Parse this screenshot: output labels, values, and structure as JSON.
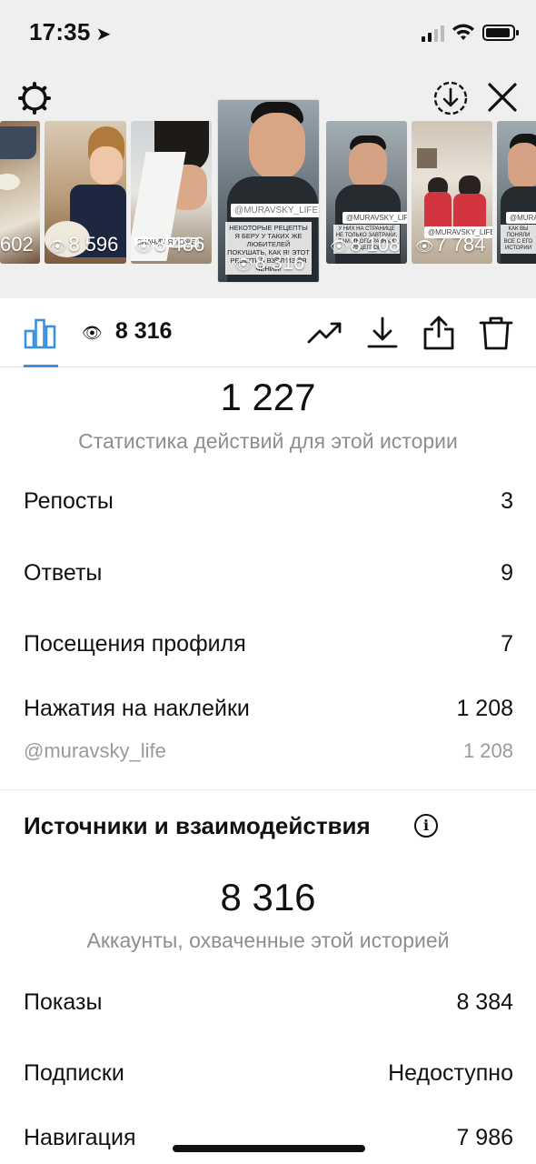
{
  "status_bar": {
    "time": "17:35",
    "location_glyph": "➤"
  },
  "header": {
    "settings_icon": "gear-icon",
    "download_icon": "download-circle-icon",
    "close_icon": "close-icon"
  },
  "thumbnails": [
    {
      "count": "602",
      "partial": true
    },
    {
      "count": "8 596"
    },
    {
      "count": "8 486",
      "overlay_text": "ЗНАЧИТ Я ТОЖЕ"
    },
    {
      "count": "8 316",
      "selected": true,
      "tag": "@MURAVSKY_LIFE",
      "caption": "НЕКОТОРЫЕ РЕЦЕПТЫ Я БЕРУ У ТАКИХ ЖЕ ЛЮБИТЕЛЕЙ ПОКУШАТЬ, КАК Я! ЭТОТ РЕЦЕПТ Я ВЗЯЛ ИЗ ЛЯ ЧЕНИЯ!"
    },
    {
      "count": "8 108",
      "tag": "@MURAVSKY_LIFE",
      "caption": "У НИХ НА СТРАНИЦЕ НЕ ТОЛЬКО ЗАВТРАКИ, ТАМ МНОГО РАЗНЫХ РЕЦЕПТОВ"
    },
    {
      "count": "7 784",
      "tag": "@MURAVSKY_LIFE"
    },
    {
      "count": "",
      "tag": "@MURAVS",
      "caption": "КАК ВЫ ПОНЯЛИ ВСЕ С ЕГО ИСТОРИИ",
      "partial": true
    }
  ],
  "toolbar": {
    "views": "8 316",
    "icons": [
      "bar-chart-icon",
      "eye-icon",
      "trending-icon",
      "download-icon",
      "share-icon",
      "trash-icon"
    ]
  },
  "actions": {
    "total": "1 227",
    "subtitle": "Статистика действий для этой истории",
    "rows": [
      {
        "label": "Репосты",
        "value": "3"
      },
      {
        "label": "Ответы",
        "value": "9"
      },
      {
        "label": "Посещения профиля",
        "value": "7"
      },
      {
        "label": "Нажатия на наклейки",
        "value": "1 208"
      }
    ],
    "sticker_sub": {
      "label": "@muravsky_life",
      "value": "1 208"
    }
  },
  "sources": {
    "title": "Источники и взаимодействия",
    "info_glyph": "i",
    "reach": "8 316",
    "reach_subtitle": "Аккаунты, охваченные этой историей",
    "rows": [
      {
        "label": "Показы",
        "value": "8 384"
      },
      {
        "label": "Подписки",
        "value": "Недоступно"
      },
      {
        "label": "Навигация",
        "value": "7 986"
      }
    ]
  },
  "colors": {
    "accent": "#3d8fe0",
    "muted": "#8e8e8e",
    "top_bg": "#efefef"
  }
}
